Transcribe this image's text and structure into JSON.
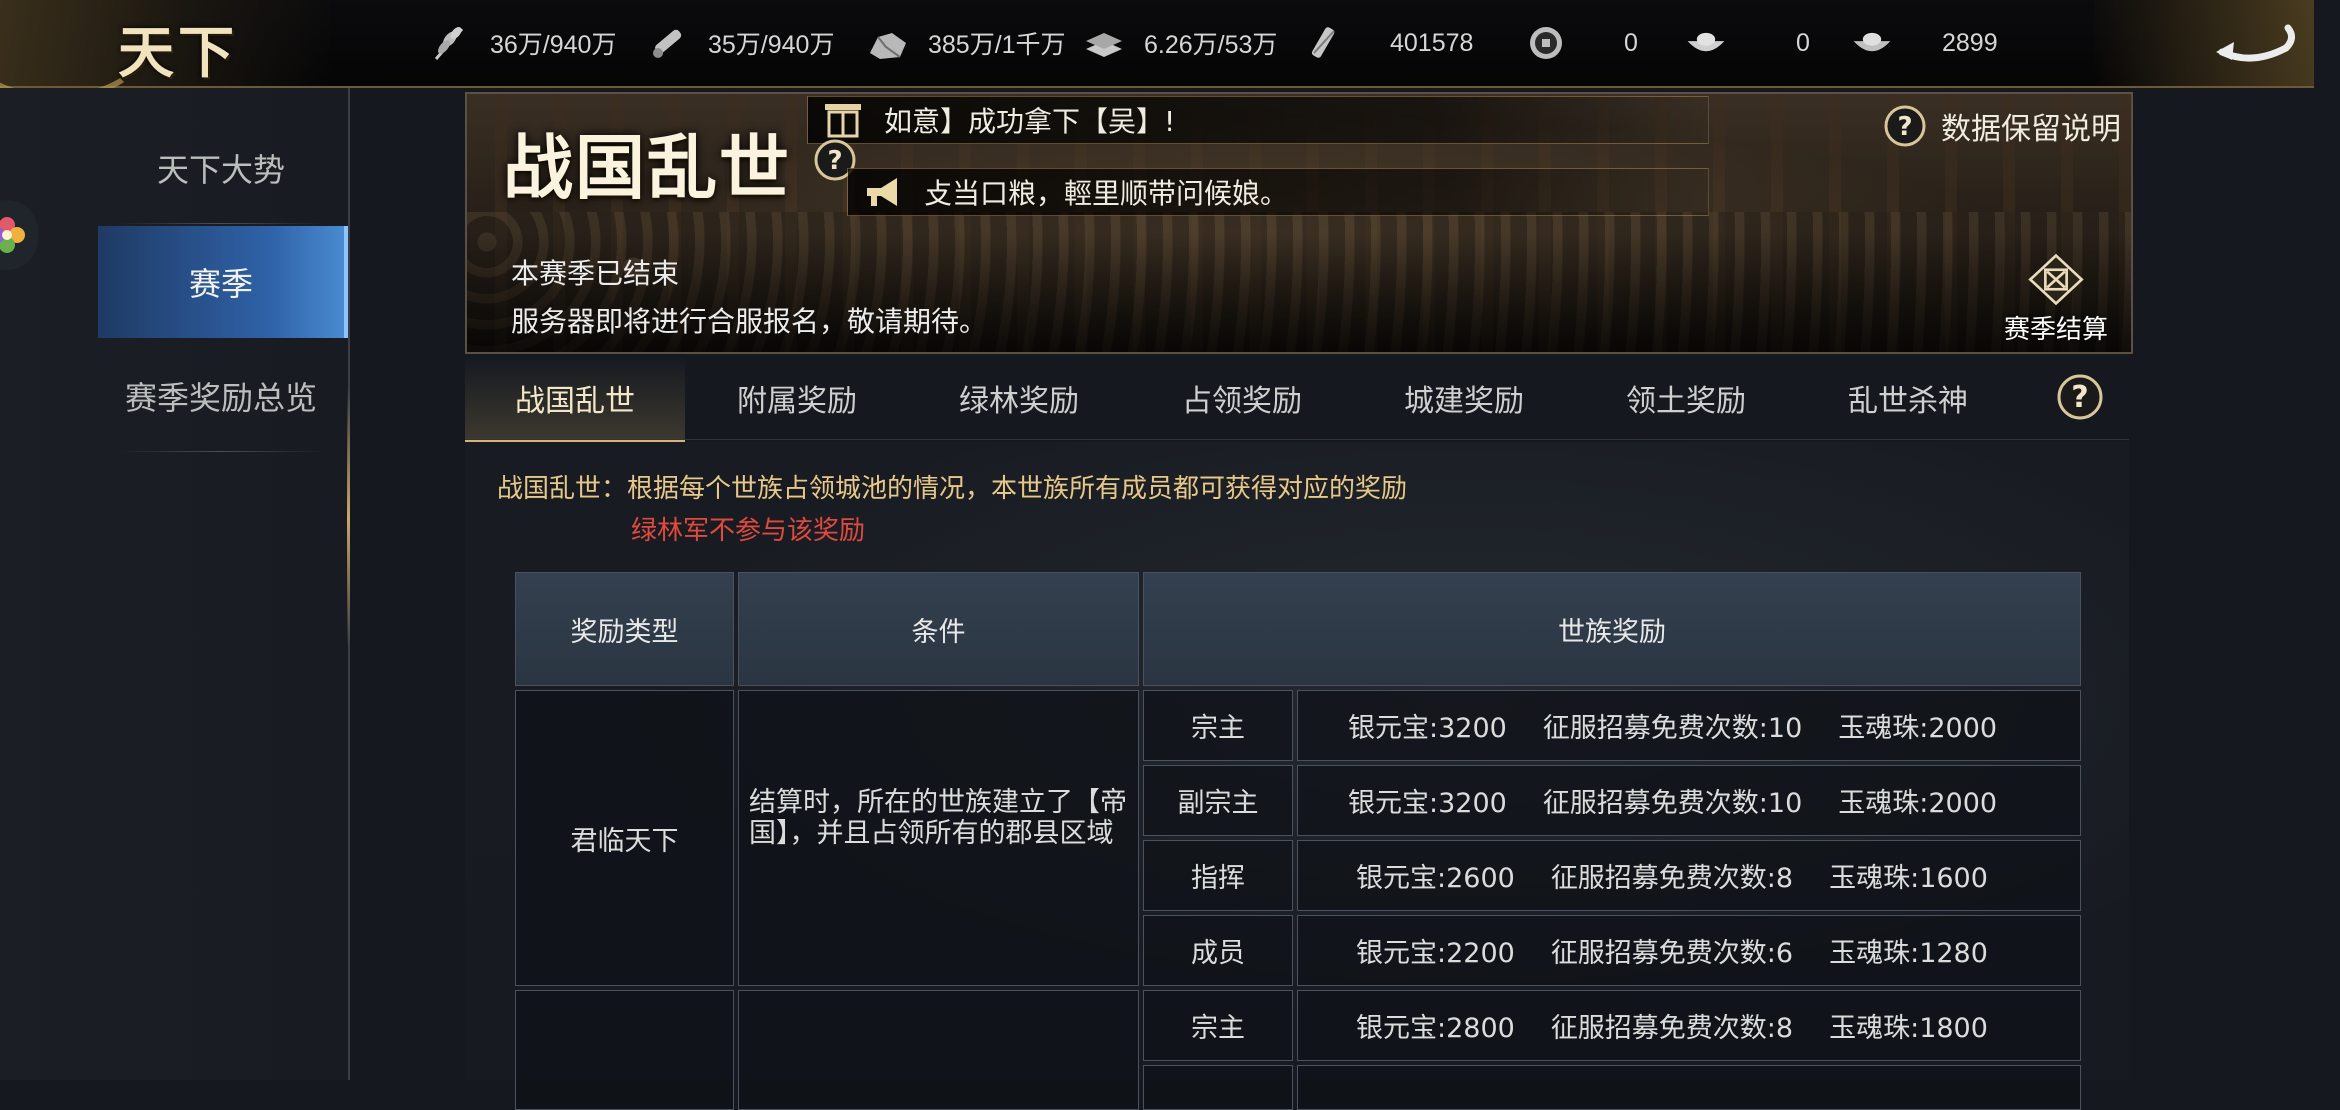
{
  "app": {
    "logo_text": "天下"
  },
  "resources": [
    {
      "icon": "grain-icon",
      "value": "36万/940万"
    },
    {
      "icon": "wood-icon",
      "value": "35万/940万"
    },
    {
      "icon": "stone-icon",
      "value": "385万/1千万"
    },
    {
      "icon": "iron-icon",
      "value": "6.26万/53万"
    },
    {
      "icon": "decree-icon",
      "value": "401578"
    },
    {
      "icon": "coin-icon",
      "value": "0"
    },
    {
      "icon": "gold-ingot-icon",
      "value": "0"
    },
    {
      "icon": "silver-ingot-icon",
      "value": "2899"
    }
  ],
  "sidebar": {
    "items": [
      {
        "label": "天下大势",
        "active": false
      },
      {
        "label": "赛季",
        "active": true
      },
      {
        "label": "赛季奖励总览",
        "active": false
      }
    ]
  },
  "banner": {
    "title": "战国乱世",
    "messages": [
      "如意】成功拿下【吴】!",
      "攴当口粮，輕里顺带问候娘。"
    ],
    "data_note": "数据保留说明",
    "status_line_1": "本赛季已结束",
    "status_line_2": "服务器即将进行合服报名，敬请期待。",
    "settle_label": "赛季结算"
  },
  "tabs": [
    {
      "label": "战国乱世",
      "active": true
    },
    {
      "label": "附属奖励",
      "active": false
    },
    {
      "label": "绿林奖励",
      "active": false
    },
    {
      "label": "占领奖励",
      "active": false
    },
    {
      "label": "城建奖励",
      "active": false
    },
    {
      "label": "领土奖励",
      "active": false
    },
    {
      "label": "乱世杀神",
      "active": false
    }
  ],
  "content": {
    "description": "战国乱世：根据每个世族占领城池的情况，本世族所有成员都可获得对应的奖励",
    "note": "绿林军不参与该奖励",
    "table": {
      "headers": [
        "奖励类型",
        "条件",
        "世族奖励"
      ],
      "groups": [
        {
          "type": "君临天下",
          "condition": "结算时，所在的世族建立了【帝国】，并且占领所有的郡县区域",
          "rows": [
            {
              "role": "宗主",
              "silver": "银元宝:3200",
              "recruit": "征服招募免费次数:10",
              "jade": "玉魂珠:2000"
            },
            {
              "role": "副宗主",
              "silver": "银元宝:3200",
              "recruit": "征服招募免费次数:10",
              "jade": "玉魂珠:2000"
            },
            {
              "role": "指挥",
              "silver": "银元宝:2600",
              "recruit": "征服招募免费次数:8",
              "jade": "玉魂珠:1600"
            },
            {
              "role": "成员",
              "silver": "银元宝:2200",
              "recruit": "征服招募免费次数:6",
              "jade": "玉魂珠:1280"
            }
          ]
        },
        {
          "type": "",
          "condition": "",
          "rows": [
            {
              "role": "宗主",
              "silver": "银元宝:2800",
              "recruit": "征服招募免费次数:8",
              "jade": "玉魂珠:1800"
            }
          ]
        }
      ]
    }
  },
  "colors": {
    "accent_gold": "#d6b476",
    "active_nav_blue": "#2f62a8",
    "description_gold": "#e8c888",
    "warning_red": "#e04a3e"
  }
}
